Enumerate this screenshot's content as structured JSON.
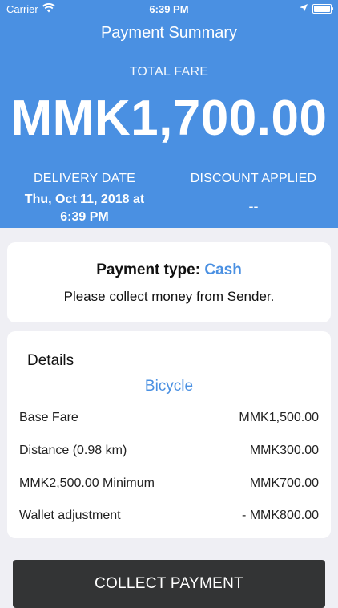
{
  "status_bar": {
    "carrier": "Carrier",
    "time": "6:39 PM",
    "icons": [
      "wifi-icon",
      "location-arrow-icon",
      "battery-icon"
    ]
  },
  "header": {
    "title": "Payment Summary",
    "fare_label": "TOTAL FARE",
    "fare_amount": "MMK1,700.00",
    "delivery_date_label": "DELIVERY DATE",
    "delivery_date_line1": "Thu, Oct 11, 2018 at",
    "delivery_date_line2": "6:39 PM",
    "discount_label": "DISCOUNT APPLIED",
    "discount_value": "--"
  },
  "payment": {
    "type_label": "Payment type:",
    "type_value": "Cash",
    "note": "Please collect money from Sender."
  },
  "details": {
    "title": "Details",
    "vehicle": "Bicycle",
    "rows": [
      {
        "label": "Base Fare",
        "value": "MMK1,500.00"
      },
      {
        "label": "Distance (0.98 km)",
        "value": "MMK300.00"
      },
      {
        "label": "MMK2,500.00 Minimum",
        "value": "MMK700.00"
      },
      {
        "label": "Wallet adjustment",
        "value": "- MMK800.00"
      }
    ]
  },
  "action": {
    "collect_label": "COLLECT PAYMENT"
  },
  "colors": {
    "header_bg": "#4a90e2",
    "accent": "#4a90e2",
    "button_bg": "#333435",
    "page_bg": "#efeff4"
  }
}
